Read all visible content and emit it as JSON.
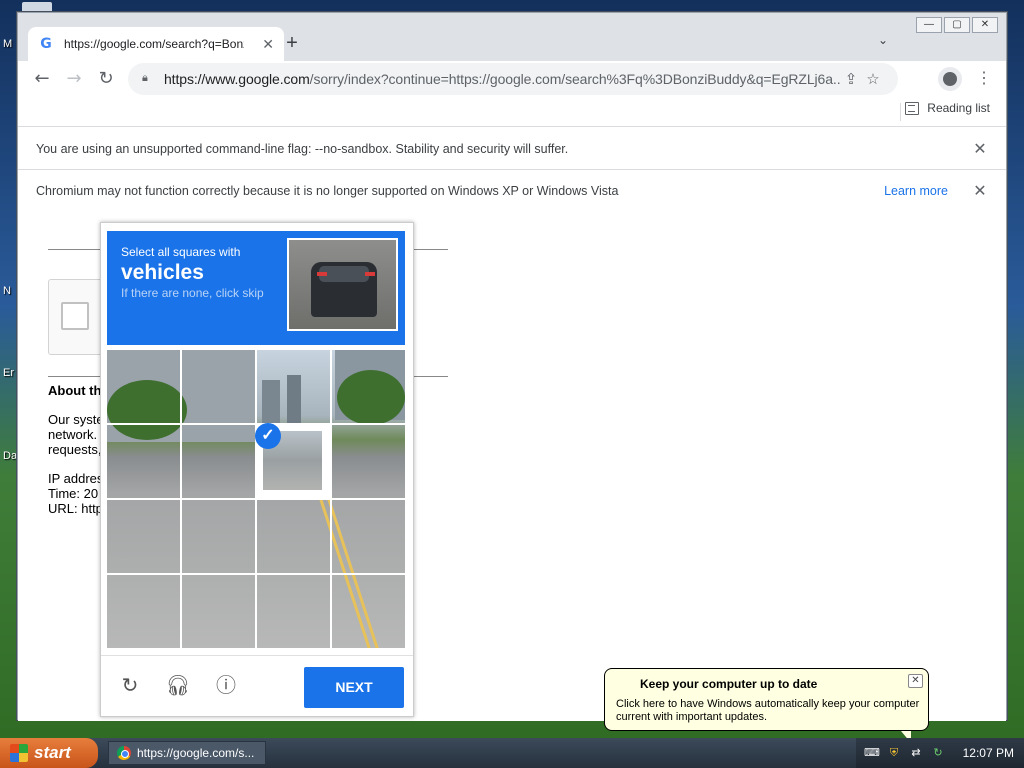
{
  "desktop": {
    "edge_labels": [
      "M",
      "N",
      "Er",
      "Da"
    ]
  },
  "tab": {
    "title": "https://google.com/search?q=Bonz",
    "favicon": "G"
  },
  "window_controls": [
    "minimize",
    "restore",
    "close"
  ],
  "omnibox": {
    "url_host": "https://www.google.com",
    "url_rest": "/sorry/index?continue=https://google.com/search%3Fq%3DBonziBuddy&q=EgRZLj6a..."
  },
  "bookmarks": {
    "reading_list": "Reading list"
  },
  "infobars": [
    {
      "message": "You are using an unsupported command-line flag: --no-sandbox. Stability and security will suffer."
    },
    {
      "message": "Chromium may not function correctly because it is no longer supported on Windows XP or Windows Vista",
      "link": "Learn more"
    }
  ],
  "page": {
    "about_heading": "About th",
    "about_paragraph": "Our syste\nnetwork.\nrequests,",
    "details": "IP addres\nTime: 20\nURL: http"
  },
  "captcha": {
    "select_text": "Select all squares with",
    "target": "vehicles",
    "skip_hint": "If there are none, click skip",
    "selected_cells": [
      6
    ],
    "next_label": "NEXT",
    "icons": {
      "reload": "reload-icon",
      "audio": "headphones-icon",
      "info": "info-icon"
    },
    "accent": "#1a73e8"
  },
  "balloon": {
    "title": "Keep your computer up to date",
    "text": "Click here to have Windows automatically keep your computer current with important updates."
  },
  "taskbar": {
    "start_label": "start",
    "task_item": "https://google.com/s...",
    "clock": "12:07 PM"
  }
}
